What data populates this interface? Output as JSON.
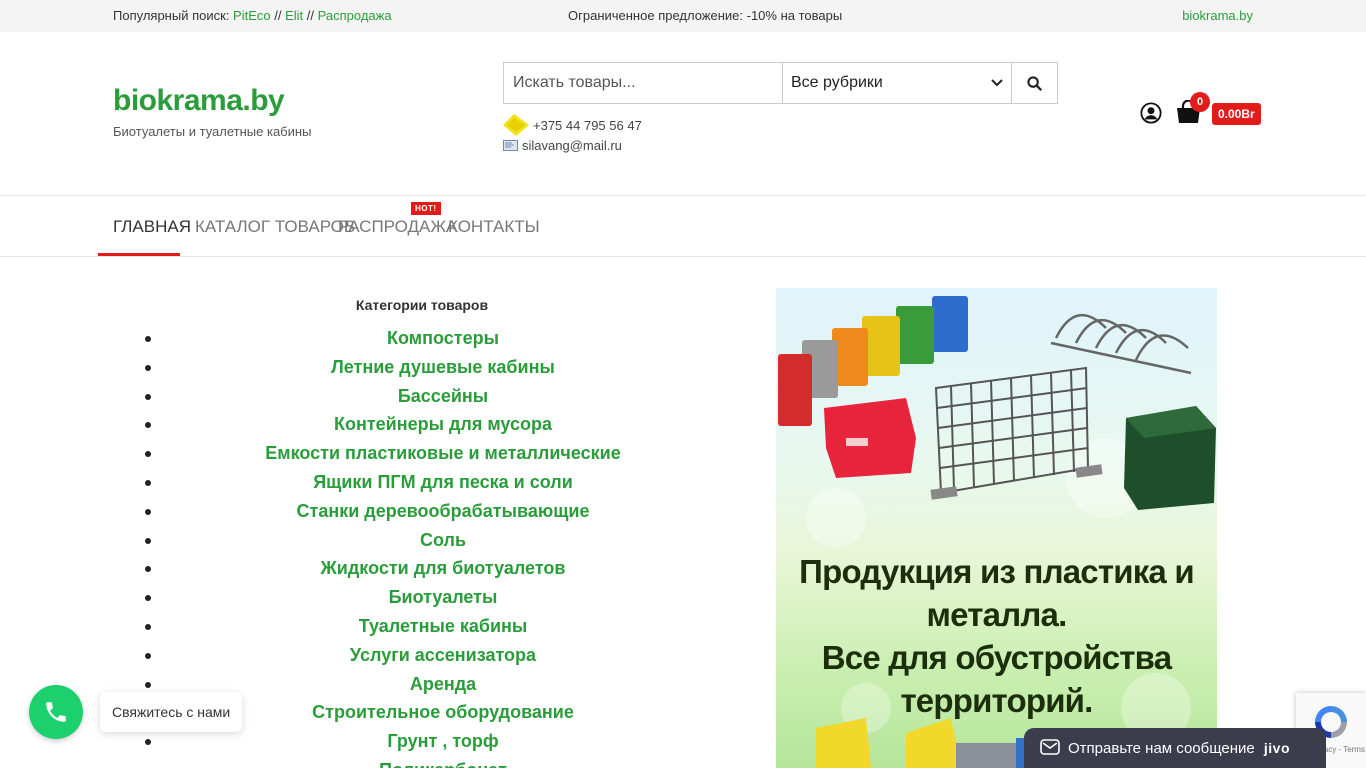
{
  "topbar": {
    "popular_label": "Популярный поиск:",
    "links": [
      "PitEco",
      "Elit",
      "Распродажа"
    ],
    "separator": "//",
    "offer": "Ограниченное предложение: -10% на  товары",
    "site_link": "biokrama.by"
  },
  "header": {
    "logo": "biokrama.by",
    "tagline": "Биотуалеты и туалетные кабины",
    "search_placeholder": "Искать товары...",
    "category_select": "Все рубрики",
    "phone": "+375 44 795 56 47",
    "email": "silavang@mail.ru",
    "cart_count": "0",
    "cart_total": "0.00Br"
  },
  "nav": {
    "items": [
      "Главная",
      "Каталог товаров",
      "Распродажа",
      "Контакты"
    ],
    "hot_badge": "HOT!"
  },
  "main": {
    "categories_title": "Категории товаров",
    "categories": [
      "Компостеры",
      "Летние душевые кабины",
      "Бассейны",
      "Контейнеры для мусора",
      "Емкости пластиковые и металлические",
      "Ящики ПГМ для песка и соли",
      "Станки деревообрабатывающие",
      "Соль",
      "Жидкости для биотуалетов",
      "Биотуалеты",
      "Туалетные кабины",
      "Услуги ассенизатора",
      "Аренда",
      "Строительное оборудование",
      "Грунт , торф",
      "Поликарбонат"
    ],
    "banner_line1": "Продукция из пластика и металла.",
    "banner_line2": "Все для обустройства территорий."
  },
  "widgets": {
    "callback_label": "Свяжитесь с нами",
    "chat_label": "Отправьте нам сообщение",
    "chat_brand": "jivo",
    "recaptcha_text": "Privacy - Terms"
  },
  "colors": {
    "accent_green": "#2a9d3a",
    "accent_red": "#e21b1b",
    "phone_green": "#1cd16d",
    "chat_bg": "#3b3d4d"
  }
}
